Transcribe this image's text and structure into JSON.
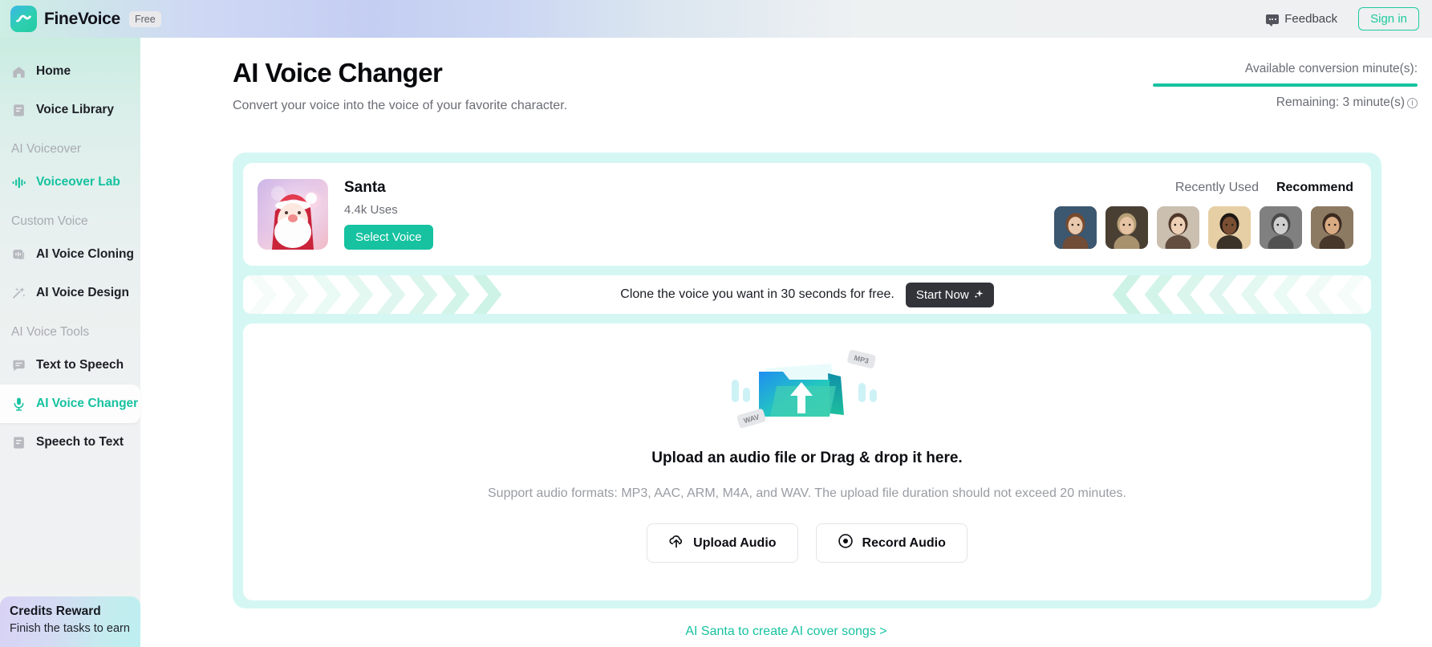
{
  "header": {
    "brand_name": "FineVoice",
    "plan_badge": "Free",
    "feedback_label": "Feedback",
    "signin_label": "Sign in",
    "logo_icon": "finevoice-wave-logo",
    "feedback_icon": "chat-bubble-icon"
  },
  "sidebar": {
    "items": [
      {
        "type": "item",
        "label": "Home",
        "icon": "home-icon",
        "active": false
      },
      {
        "type": "item",
        "label": "Voice Library",
        "icon": "library-icon",
        "active": false
      },
      {
        "type": "section",
        "label": "AI Voiceover"
      },
      {
        "type": "item",
        "label": "Voiceover Lab",
        "icon": "waveform-icon",
        "active": false,
        "highlight": true
      },
      {
        "type": "section",
        "label": "Custom Voice"
      },
      {
        "type": "item",
        "label": "AI Voice Cloning",
        "icon": "voice-clone-icon",
        "active": false
      },
      {
        "type": "item",
        "label": "AI Voice Design",
        "icon": "magic-wand-icon",
        "active": false
      },
      {
        "type": "section",
        "label": "AI Voice Tools"
      },
      {
        "type": "item",
        "label": "Text to Speech",
        "icon": "speech-bubble-icon",
        "active": false
      },
      {
        "type": "item",
        "label": "AI Voice Changer",
        "icon": "microphone-icon",
        "active": true
      },
      {
        "type": "item",
        "label": "Speech to Text",
        "icon": "document-icon",
        "active": false
      }
    ],
    "credits": {
      "title": "Credits Reward",
      "subtitle": "Finish the tasks to earn"
    }
  },
  "main": {
    "title": "AI Voice Changer",
    "subtitle": "Convert your voice into the voice of your favorite character.",
    "minutes": {
      "available_label": "Available conversion minute(s):",
      "remaining_label": "Remaining: 3 minute(s)",
      "progress_percent": 100,
      "info_icon": "info-icon",
      "bar_color": "#16c2a0"
    },
    "voice_card": {
      "name": "Santa",
      "uses": "4.4k Uses",
      "select_label": "Select Voice",
      "avatar_icon": "santa-avatar",
      "tabs": [
        {
          "label": "Recently Used",
          "active": false
        },
        {
          "label": "Recommend",
          "active": true
        }
      ],
      "avatars": [
        {
          "name": "voice-avatar-1",
          "bg": "#3c5770"
        },
        {
          "name": "voice-avatar-2",
          "bg": "#4a3f33"
        },
        {
          "name": "voice-avatar-3",
          "bg": "#cbbfb0"
        },
        {
          "name": "voice-avatar-4",
          "bg": "#e6cfa4"
        },
        {
          "name": "voice-avatar-5",
          "bg": "#808080"
        },
        {
          "name": "voice-avatar-6",
          "bg": "#8d7a63"
        }
      ]
    },
    "clone_banner": {
      "text": "Clone the voice you want in 30 seconds for free.",
      "button_label": "Start Now",
      "button_icon": "sparkle-icon"
    },
    "upload": {
      "illustration_icon": "folder-upload-illustration",
      "tag_mp3": "MP3",
      "tag_wav": "WAV",
      "title": "Upload an audio file or Drag & drop it here.",
      "formats": "Support audio formats: MP3, AAC, ARM, M4A, and WAV. The upload file duration should not exceed 20 minutes.",
      "upload_button": "Upload Audio",
      "upload_icon": "cloud-upload-icon",
      "record_button": "Record Audio",
      "record_icon": "record-dot-icon"
    },
    "bottom_link": "AI Santa to create AI cover songs >"
  },
  "colors": {
    "accent": "#16c2a0",
    "mint_panel": "#d5f7f3",
    "dark_button": "#32343a"
  }
}
